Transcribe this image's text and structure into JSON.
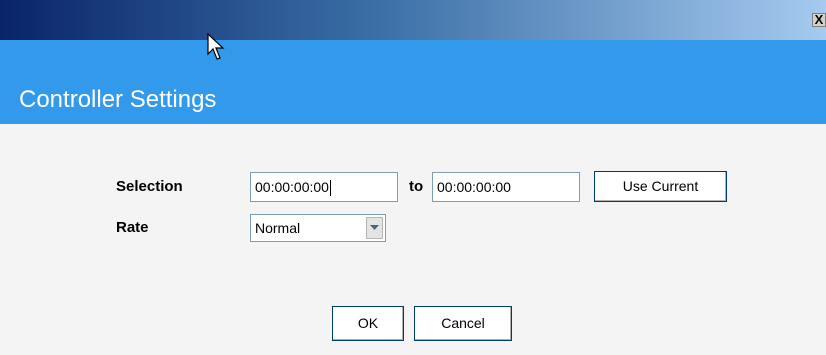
{
  "window": {
    "close_label": "X"
  },
  "header": {
    "title": "Controller Settings"
  },
  "form": {
    "selection_label": "Selection",
    "selection_start": "00:00:00:00",
    "to_label": "to",
    "selection_end": "00:00:00:00",
    "use_current_label": "Use Current",
    "rate_label": "Rate",
    "rate_value": "Normal"
  },
  "footer": {
    "ok_label": "OK",
    "cancel_label": "Cancel"
  },
  "colors": {
    "header_blue": "#3399ea",
    "titlebar_dark": "#0a246a",
    "titlebar_light": "#a6caf0"
  }
}
